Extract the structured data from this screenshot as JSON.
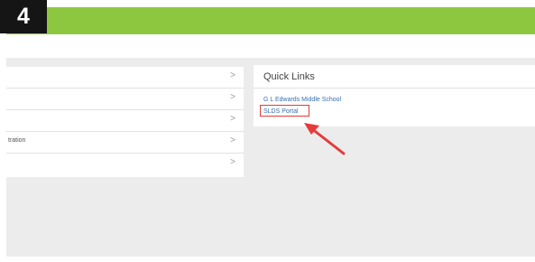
{
  "step_badge": "4",
  "sidebar": {
    "items": [
      {
        "label": "",
        "chevron": ">"
      },
      {
        "label": "",
        "chevron": ">"
      },
      {
        "label": "",
        "chevron": ">"
      },
      {
        "label": "tration",
        "chevron": ">"
      },
      {
        "label": "",
        "chevron": ">"
      }
    ]
  },
  "quick_links": {
    "title": "Quick Links",
    "links": [
      {
        "label": "G L Edwards Middle School"
      },
      {
        "label": "SLDS Portal"
      }
    ]
  },
  "colors": {
    "top_bar": "#8dc63f",
    "badge": "#151515",
    "highlight": "#e53b3b",
    "link": "#3a6fb0"
  }
}
